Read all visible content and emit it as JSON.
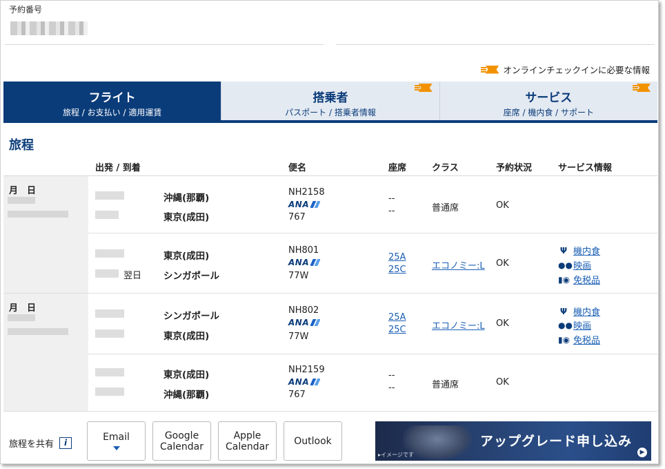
{
  "booking": {
    "label": "予約番号"
  },
  "checkin_note": "オンラインチェックインに必要な情報",
  "tabs": [
    {
      "title": "フライト",
      "sub": "旅程 / お支払い / 適用運賃"
    },
    {
      "title": "搭乗者",
      "sub": "パスポート / 搭乗者情報"
    },
    {
      "title": "サービス",
      "sub": "座席 / 機内食 / サポート"
    }
  ],
  "itinerary": {
    "title": "旅程",
    "headers": {
      "depart_arrive": "出発 / 到着",
      "flight": "便名",
      "seat": "座席",
      "class": "クラス",
      "status": "予約状況",
      "service": "サービス情報"
    },
    "date_label": "月　日",
    "flights": [
      {
        "from": "沖縄(那覇)",
        "to": "東京(成田)",
        "flight": "NH2158",
        "airline": "ANA",
        "aircraft": "767",
        "seat1": "--",
        "seat2": "--",
        "class": "普通席",
        "status": "OK"
      },
      {
        "from": "東京(成田)",
        "to": "シンガポール",
        "next_day": "翌日",
        "flight": "NH801",
        "airline": "ANA",
        "aircraft": "77W",
        "seat1": "25A",
        "seat2": "25C",
        "class": "エコノミー:L",
        "status": "OK",
        "services": [
          "機内食",
          "映画",
          "免税品"
        ]
      },
      {
        "from": "シンガポール",
        "to": "東京(成田)",
        "flight": "NH802",
        "airline": "ANA",
        "aircraft": "77W",
        "seat1": "25A",
        "seat2": "25C",
        "class": "エコノミー:L",
        "status": "OK",
        "services": [
          "機内食",
          "映画",
          "免税品"
        ]
      },
      {
        "from": "東京(成田)",
        "to": "沖縄(那覇)",
        "flight": "NH2159",
        "airline": "ANA",
        "aircraft": "767",
        "seat1": "--",
        "seat2": "--",
        "class": "普通席",
        "status": "OK"
      }
    ]
  },
  "share": {
    "label": "旅程を共有",
    "info_glyph": "i",
    "buttons": [
      {
        "line1": "Email"
      },
      {
        "line1": "Google",
        "line2": "Calendar"
      },
      {
        "line1": "Apple",
        "line2": "Calendar"
      },
      {
        "line1": "Outlook"
      }
    ]
  },
  "upgrade_banner": {
    "text": "アップグレード申し込み",
    "note": "▸イメージです",
    "arrow": "▶"
  },
  "colors": {
    "brand_navy": "#0b3c7a",
    "link_blue": "#1a5fb4",
    "ticket_orange": "#f29200"
  }
}
